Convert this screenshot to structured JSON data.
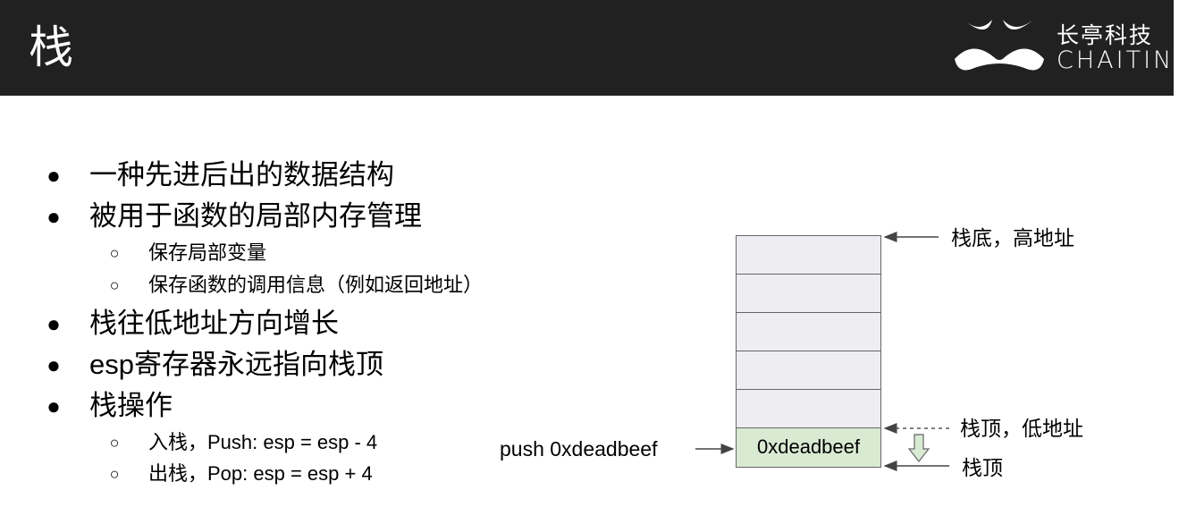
{
  "header": {
    "title": "栈",
    "logo": {
      "cn": "长亭科技",
      "en": "CHAITIN"
    }
  },
  "bullets": [
    {
      "level": 1,
      "text": "一种先进后出的数据结构"
    },
    {
      "level": 1,
      "text": "被用于函数的局部内存管理"
    },
    {
      "level": 2,
      "text": "保存局部变量"
    },
    {
      "level": 2,
      "text": "保存函数的调用信息（例如返回地址）"
    },
    {
      "level": 1,
      "text": "栈往低地址方向增长"
    },
    {
      "level": 1,
      "text": "esp寄存器永远指向栈顶"
    },
    {
      "level": 1,
      "text": "栈操作"
    },
    {
      "level": 2,
      "text": "入栈，Push: esp = esp - 4"
    },
    {
      "level": 2,
      "text": "出栈，Pop: esp = esp + 4"
    }
  ],
  "bullet_symbols": {
    "level1": "●",
    "level2": "○"
  },
  "diagram": {
    "pushed_value": "0xdeadbeef",
    "push_label": "push 0xdeadbeef",
    "bottom_label": "栈底，高地址",
    "old_top_label": "栈顶，低地址",
    "new_top_label": "栈顶",
    "colors": {
      "cell": "#eeeef2",
      "pushed_cell": "#d9ead3",
      "header_bg": "#212121"
    }
  }
}
